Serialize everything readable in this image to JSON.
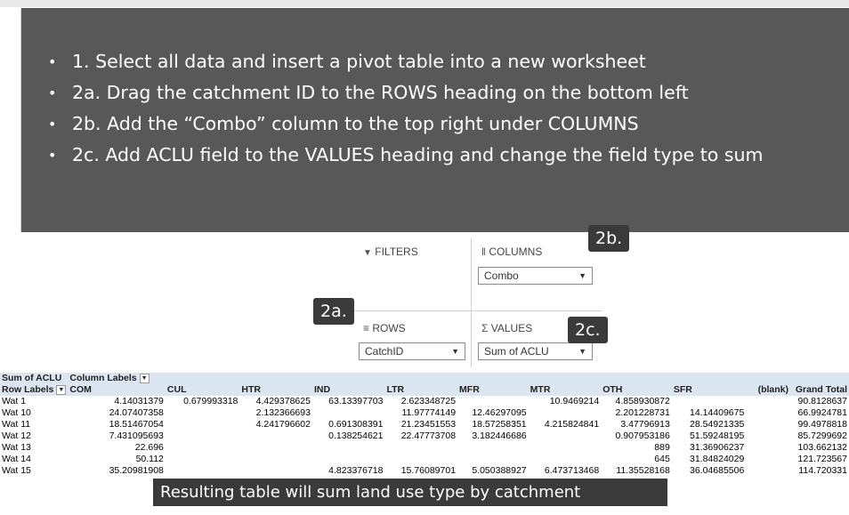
{
  "slide": {
    "steps": [
      "1. Select all data and insert a pivot table into a new worksheet",
      "2a. Drag the catchment ID to the ROWS heading on the bottom left",
      "2b. Add the “Combo” column to the top right under COLUMNS",
      "2c. Add ACLU field to the VALUES heading and change the field type to sum"
    ],
    "bullet": "•"
  },
  "pivot_fields": {
    "filters_label": "FILTERS",
    "columns_label": "COLUMNS",
    "rows_label": "ROWS",
    "values_label": "VALUES",
    "columns_value": "Combo",
    "rows_value": "CatchID",
    "values_value": "Sum of ACLU",
    "filter_icon": "▼",
    "columns_icon": "‖",
    "rows_icon": "≡",
    "values_icon": "Σ",
    "dropdown_arrow": "▼"
  },
  "callouts": {
    "c2a": "2a.",
    "c2b": "2b.",
    "c2c": "2c."
  },
  "pivot_table": {
    "corner": "Sum of ACLU",
    "col_labels": "Column Labels",
    "row_labels": "Row Labels",
    "columns": [
      "COM",
      "CUL",
      "HTR",
      "IND",
      "LTR",
      "MFR",
      "MTR",
      "OTH",
      "SFR",
      "(blank)",
      "Grand Total"
    ],
    "rows": [
      [
        "Wat 1",
        "4.14031379",
        "0.679993318",
        "4.429378625",
        "63.13397703",
        "2.623348725",
        "",
        "10.9469214",
        "4.858930872",
        "",
        "",
        "90.8128637"
      ],
      [
        "Wat 10",
        "24.07407358",
        "",
        "2.132366693",
        "",
        "11.97774149",
        "12.46297095",
        "",
        "2.201228731",
        "14.14409675",
        "",
        "66.9924781"
      ],
      [
        "Wat 11",
        "18.51467054",
        "",
        "4.241796602",
        "0.691308391",
        "21.23451553",
        "18.57258351",
        "4.215824841",
        "3.47796913",
        "28.54921335",
        "",
        "99.4978818"
      ],
      [
        "Wat 12",
        "7.431095693",
        "",
        "",
        "0.138254621",
        "22.47773708",
        "3.182446686",
        "",
        "0.907953186",
        "51.59248195",
        "",
        "85.7299692"
      ],
      [
        "Wat 13",
        "22.696",
        "",
        "",
        "",
        "",
        "",
        "",
        "889",
        "31.36906237",
        "",
        "103.662132"
      ],
      [
        "Wat 14",
        "50.112",
        "",
        "",
        "",
        "",
        "",
        "",
        "645",
        "31.84824029",
        "",
        "121.723567"
      ],
      [
        "Wat 15",
        "35.20981908",
        "",
        "",
        "4.823376718",
        "15.76089701",
        "5.050388927",
        "6.473713468",
        "11.35528168",
        "36.04685506",
        "",
        "114.720331"
      ]
    ]
  },
  "result_banner": "Resulting table will sum land use type by catchment"
}
